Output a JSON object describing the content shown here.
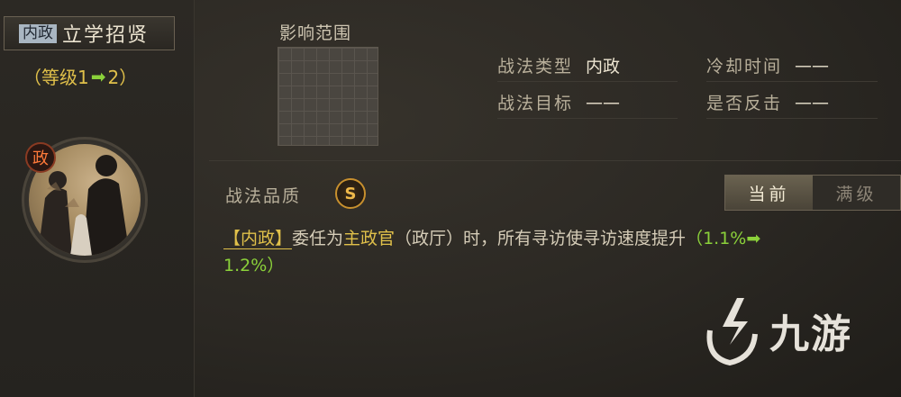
{
  "skill": {
    "type_tag": "内政",
    "name": "立学招贤",
    "level_open": "（等级1",
    "level_arrow": "➡",
    "level_close": "2）",
    "portrait_badge": "政"
  },
  "range": {
    "label": "影响范围"
  },
  "info": {
    "type_label": "战法类型",
    "type_value": "内政",
    "cooldown_label": "冷却时间",
    "cooldown_value": "——",
    "target_label": "战法目标",
    "target_value": "——",
    "counter_label": "是否反击",
    "counter_value": "——"
  },
  "quality": {
    "label": "战法品质",
    "grade": "S"
  },
  "toggle": {
    "current": "当前",
    "max": "满级"
  },
  "description": {
    "tag": "【内政】",
    "part1": "委任为",
    "role": "主政官",
    "part2": "（政厅）时，所有寻访使寻访速度提升",
    "num_open": "（1.1%",
    "arrow": "➡",
    "num_close": "1.2%）"
  },
  "watermark": {
    "text": "九游"
  },
  "colors": {
    "gold": "#e0c04a",
    "green": "#8bd13a",
    "background": "#2a2722"
  }
}
